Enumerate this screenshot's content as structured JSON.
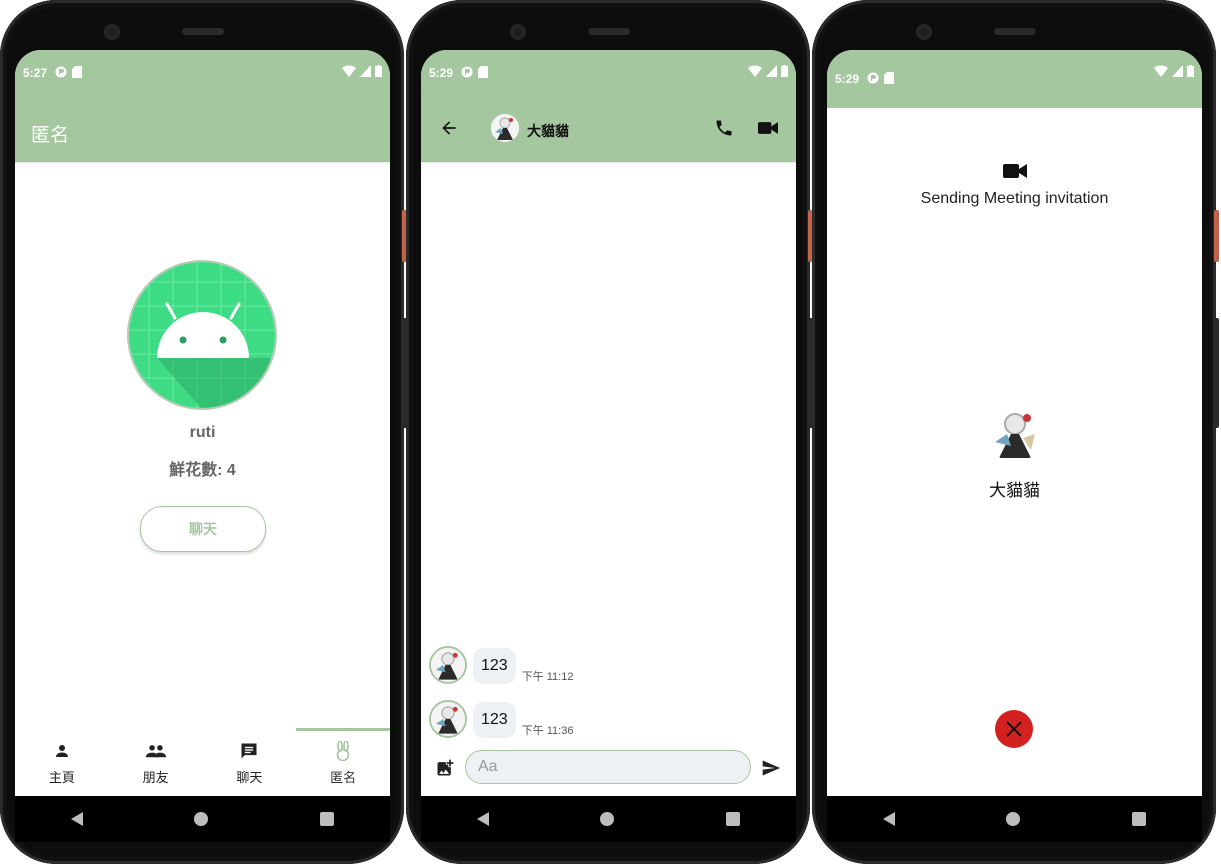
{
  "screens": [
    {
      "status": {
        "time": "5:27"
      },
      "appbar": {
        "title": "匿名"
      },
      "profile": {
        "name": "ruti",
        "flowers": "鮮花數: 4",
        "chat_button": "聊天"
      },
      "bottom_nav": [
        {
          "label": "主頁",
          "icon": "person-icon"
        },
        {
          "label": "朋友",
          "icon": "people-icon"
        },
        {
          "label": "聊天",
          "icon": "chat-icon"
        },
        {
          "label": "匿名",
          "icon": "rabbit-icon",
          "active": true
        }
      ]
    },
    {
      "status": {
        "time": "5:29"
      },
      "chat_header": {
        "name": "大貓貓"
      },
      "messages": [
        {
          "text": "123",
          "time": "下午 11:12"
        },
        {
          "text": "123",
          "time": "下午 11:36"
        }
      ],
      "composer": {
        "placeholder": "Aa"
      }
    },
    {
      "status": {
        "time": "5:29"
      },
      "meeting": {
        "title": "Sending Meeting invitation",
        "callee": "大貓貓"
      }
    }
  ],
  "colors": {
    "primary": "#a5c79f",
    "hangup": "#d32020",
    "android_green": "#3ddc84"
  }
}
